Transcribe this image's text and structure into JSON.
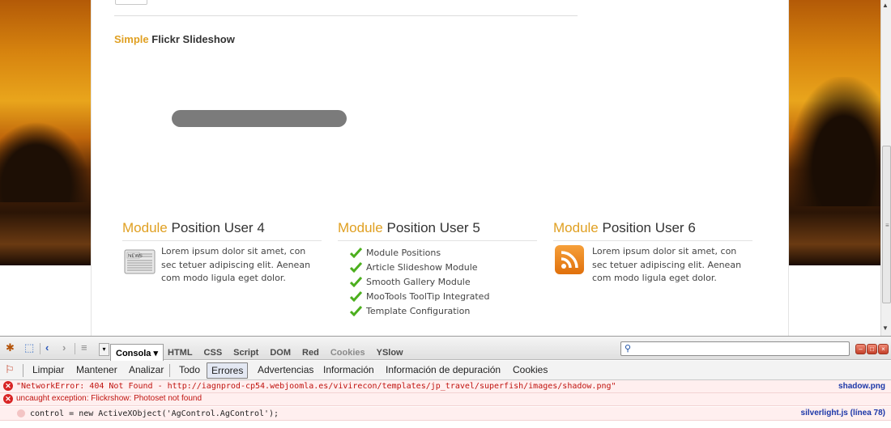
{
  "page": {
    "flickr_title_accent": "Simple",
    "flickr_title_rest": "Flickr Slideshow",
    "modules": [
      {
        "title_accent": "Module",
        "title_rest": "Position User 4",
        "icon": "news-icon",
        "text": "Lorem ipsum dolor sit amet, con sec tetuer adipiscing elit. Aenean com modo ligula eget dolor."
      },
      {
        "title_accent": "Module",
        "title_rest": "Position User 5",
        "items": [
          "Module Positions",
          "Article Slideshow Module",
          "Smooth Gallery Module",
          "MooTools ToolTip Integrated",
          "Template Configuration"
        ]
      },
      {
        "title_accent": "Module",
        "title_rest": "Position User 6",
        "icon": "rss-icon",
        "text": "Lorem ipsum dolor sit amet, con sec tetuer adipiscing elit. Aenean com modo ligula eget dolor."
      }
    ],
    "colors": {
      "accent": "#e0a022",
      "error_text": "#c0130f",
      "link": "#1b37a8"
    }
  },
  "firebug": {
    "active_tab": "Consola",
    "tabs": [
      "HTML",
      "CSS",
      "Script",
      "DOM",
      "Red",
      "Cookies",
      "YSlow"
    ],
    "search_placeholder": "",
    "filter_left": [
      "Limpiar",
      "Mantener",
      "Analizar"
    ],
    "filter_right": [
      "Todo",
      "Errores",
      "Advertencias",
      "Información",
      "Información de depuración",
      "Cookies"
    ],
    "selected_filter": "Errores"
  },
  "console": {
    "rows": [
      {
        "text": "\"NetworkError: 404 Not Found - http://iagnprod-cp54.webjoomla.es/vivirecon/templates/jp_travel/superfish/images/shadow.png\"",
        "source": "shadow.png"
      },
      {
        "text": "uncaught exception: Flickrshow: Photoset not found",
        "source": ""
      },
      {
        "text": "control = new ActiveXObject('AgControl.AgControl');",
        "source": "silverlight.js (línea 78)"
      }
    ]
  }
}
